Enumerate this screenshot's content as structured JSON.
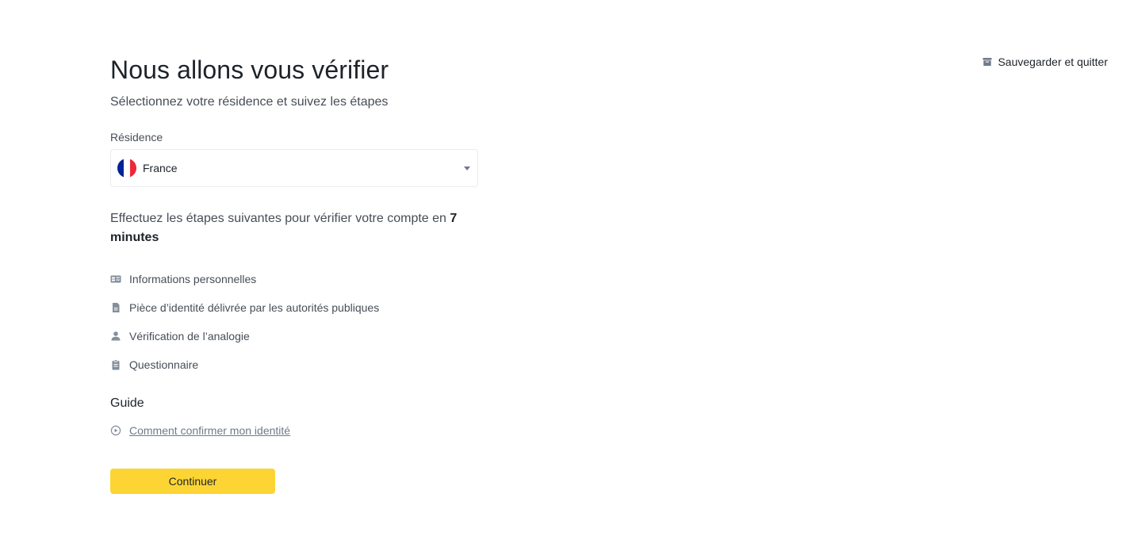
{
  "header": {
    "save_quit_label": "Sauvegarder et quitter",
    "save_icon": "archive-icon"
  },
  "main": {
    "title": "Nous allons vous vérifier",
    "subtitle": "Sélectionnez votre résidence et suivez les étapes",
    "residence_label": "Résidence",
    "residence_value": "France",
    "flag_colors": [
      "#002395",
      "#ffffff",
      "#ed2939"
    ],
    "steps_intro_prefix": "Effectuez les étapes suivantes pour vérifier votre compte en ",
    "steps_intro_time": "7 minutes",
    "steps": [
      {
        "label": "Informations personnelles",
        "icon": "id-card-icon"
      },
      {
        "label": "Pièce d’identité délivrée par les autorités publiques",
        "icon": "document-icon"
      },
      {
        "label": "Vérification de l’analogie",
        "icon": "person-icon"
      },
      {
        "label": "Questionnaire",
        "icon": "clipboard-icon"
      }
    ],
    "guide_title": "Guide",
    "guide_link": "Comment confirmer mon identité",
    "continue_label": "Continuer"
  },
  "colors": {
    "accent": "#fcd535",
    "text_primary": "#1e2329",
    "text_secondary": "#474d57",
    "icon_gray": "#848e9c"
  }
}
